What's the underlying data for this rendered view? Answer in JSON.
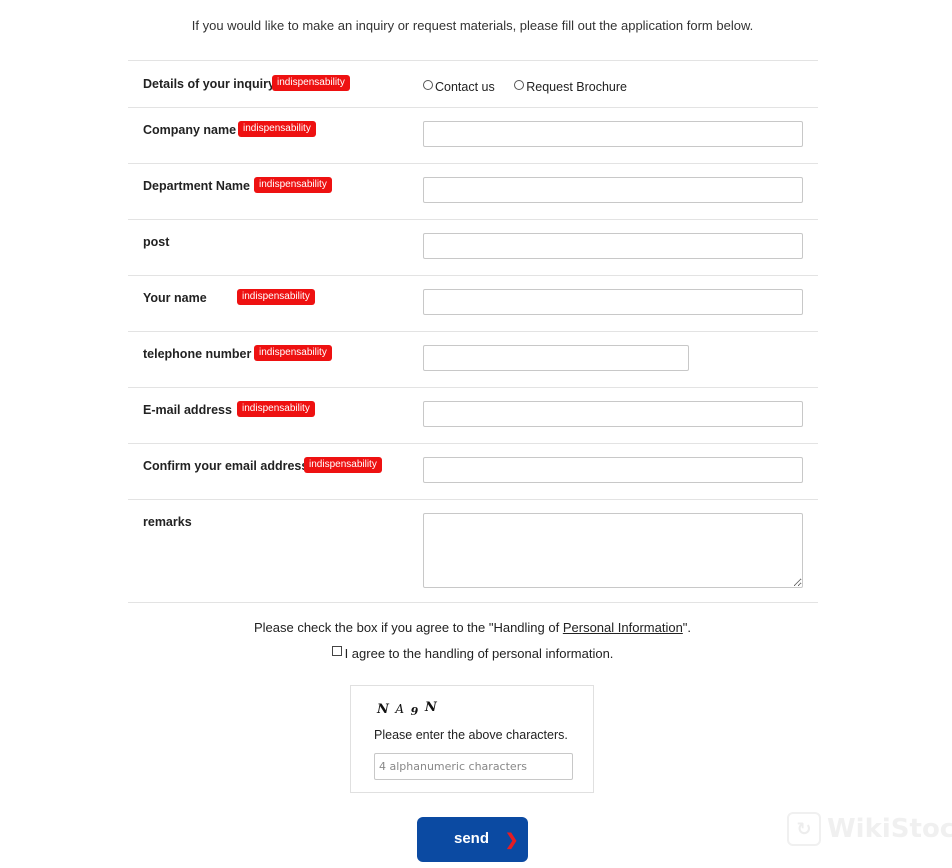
{
  "intro": "If you would like to make an inquiry or request materials, please fill out the application form below.",
  "required_badge": "indispensability",
  "colors": {
    "badge": "#ee1111",
    "send_button": "#0b4aa2",
    "send_arrow": "#e51c23"
  },
  "form": {
    "inquiry": {
      "label": "Details of your inquiry",
      "required": true,
      "options": [
        {
          "label": "Contact us",
          "selected": false
        },
        {
          "label": "Request Brochure",
          "selected": false
        }
      ]
    },
    "fields": [
      {
        "key": "company",
        "label": "Company name",
        "required": true,
        "value": ""
      },
      {
        "key": "department",
        "label": "Department Name",
        "required": true,
        "value": ""
      },
      {
        "key": "post",
        "label": "post",
        "required": false,
        "value": ""
      },
      {
        "key": "name",
        "label": "Your name",
        "required": true,
        "value": ""
      },
      {
        "key": "telephone",
        "label": "telephone number",
        "required": true,
        "value": ""
      },
      {
        "key": "email",
        "label": "E-mail address",
        "required": true,
        "value": ""
      },
      {
        "key": "email_confirm",
        "label": "Confirm your email address",
        "required": true,
        "value": ""
      },
      {
        "key": "remarks",
        "label": "remarks",
        "required": false,
        "value": ""
      }
    ]
  },
  "consent": {
    "prefix": "Please check the box if you agree to the \"Handling of ",
    "link": "Personal Information",
    "suffix": "\".",
    "checkbox_label": "I agree to the handling of personal information.",
    "checked": false
  },
  "captcha": {
    "chars": [
      "N",
      "A",
      "9",
      "N"
    ],
    "instruction": "Please enter the above characters.",
    "placeholder": "4 alphanumeric characters",
    "value": ""
  },
  "send_button": {
    "label": "send",
    "icon": "chevron-right-icon"
  },
  "watermark": {
    "text": "WikiStock",
    "icon": "wikistock-logo-icon"
  }
}
